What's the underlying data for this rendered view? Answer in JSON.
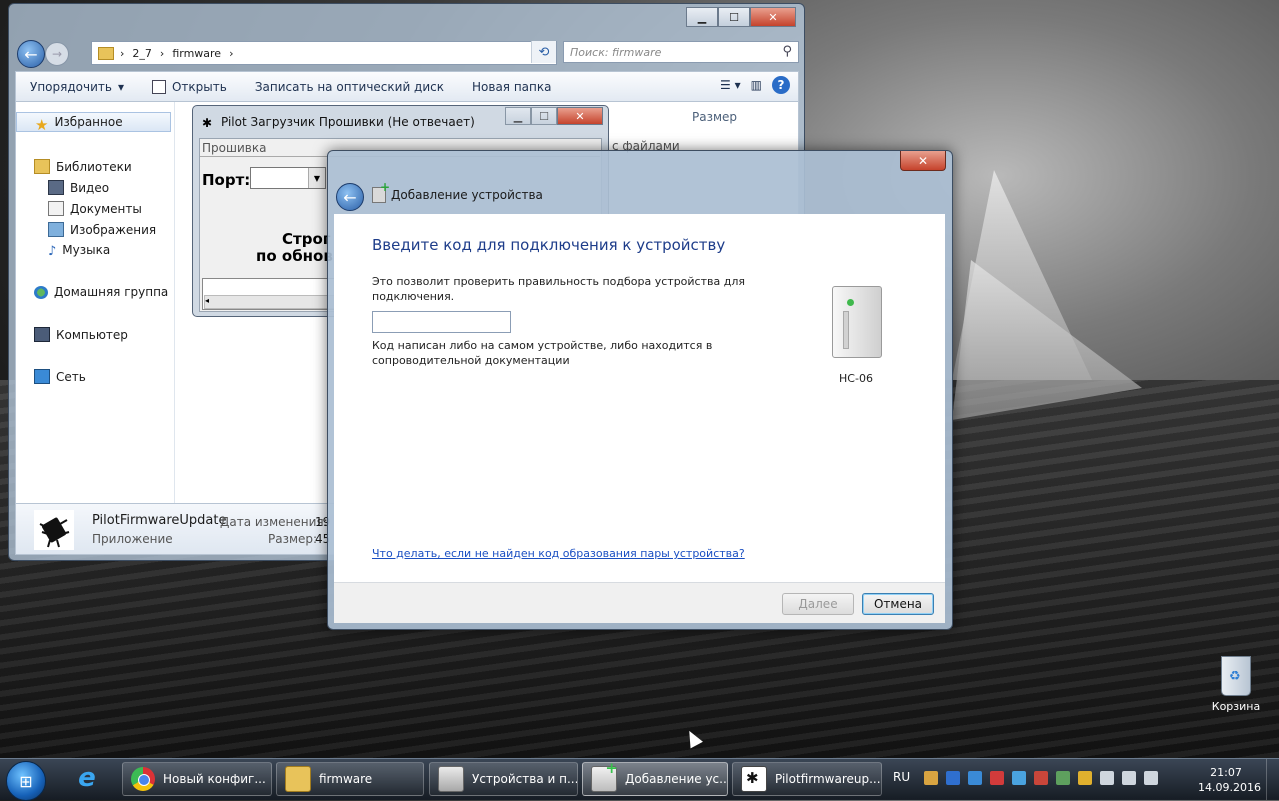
{
  "explorer": {
    "address": {
      "segments": [
        "2_7",
        "firmware"
      ]
    },
    "search_placeholder": "Поиск: firmware",
    "toolbar": {
      "organize": "Упорядочить",
      "open": "Открыть",
      "burn": "Записать на оптический диск",
      "new_folder": "Новая папка"
    },
    "nav": {
      "favorites": "Избранное",
      "libraries": "Библиотеки",
      "video": "Видео",
      "documents": "Документы",
      "images": "Изображения",
      "music": "Музыка",
      "homegroup": "Домашняя группа",
      "computer": "Компьютер",
      "network": "Сеть"
    },
    "column_size": "Размер",
    "column_partial": "с файлами",
    "details": {
      "name": "PilotFirmwareUpdate",
      "type": "Приложение",
      "modified_label": "Дата изменения:",
      "modified_value": "19",
      "size_label": "Размер:",
      "size_value": "45"
    }
  },
  "pilot": {
    "title": "Pilot Загрузчик Прошивки (Не отвечает)",
    "tab": "Прошивка",
    "port_label": "Порт:",
    "text_line1": "Строг",
    "text_line2": "по обнов"
  },
  "dialog": {
    "title": "Добавление устройства",
    "heading": "Введите код для подключения к устройству",
    "description": "Это позволит проверить правильность подбора устройства для подключения.",
    "code_value": "",
    "hint": "Код написан либо на самом устройстве, либо находится в сопроводительной документации",
    "device_name": "HC-06",
    "help_link": "Что делать, если не найден код образования пары устройства?",
    "next_button": "Далее",
    "cancel_button": "Отмена"
  },
  "desktop": {
    "recycle_bin": "Корзина"
  },
  "taskbar": {
    "tasks": [
      {
        "label": "Новый конфиг..."
      },
      {
        "label": "firmware"
      },
      {
        "label": "Устройства и п..."
      },
      {
        "label": "Добавление ус..."
      },
      {
        "label": "Pilotfirmwareup..."
      }
    ],
    "language": "RU",
    "time": "21:07",
    "date": "14.09.2016"
  },
  "colors": {
    "accent_blue": "#2a5fa7",
    "heading_blue": "#1e3d8a",
    "link_blue": "#1a4fc2",
    "close_red": "#c5432c"
  }
}
